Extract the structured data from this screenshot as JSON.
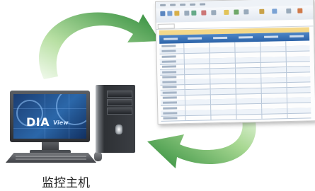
{
  "caption": "监控主机",
  "screen": {
    "logo_main": "DIA",
    "logo_sub": "View"
  },
  "colors": {
    "arrow_green_dark": "#2e8b3a",
    "arrow_green_light": "#d8f0c8",
    "sheet_header_blue": "#2c63a8",
    "sheet_title_yellow": "#f4d889"
  },
  "icons": [
    "curved-arrow-top",
    "curved-arrow-bottom",
    "spreadsheet",
    "monitor",
    "pc-tower",
    "keyboard",
    "mouse"
  ]
}
